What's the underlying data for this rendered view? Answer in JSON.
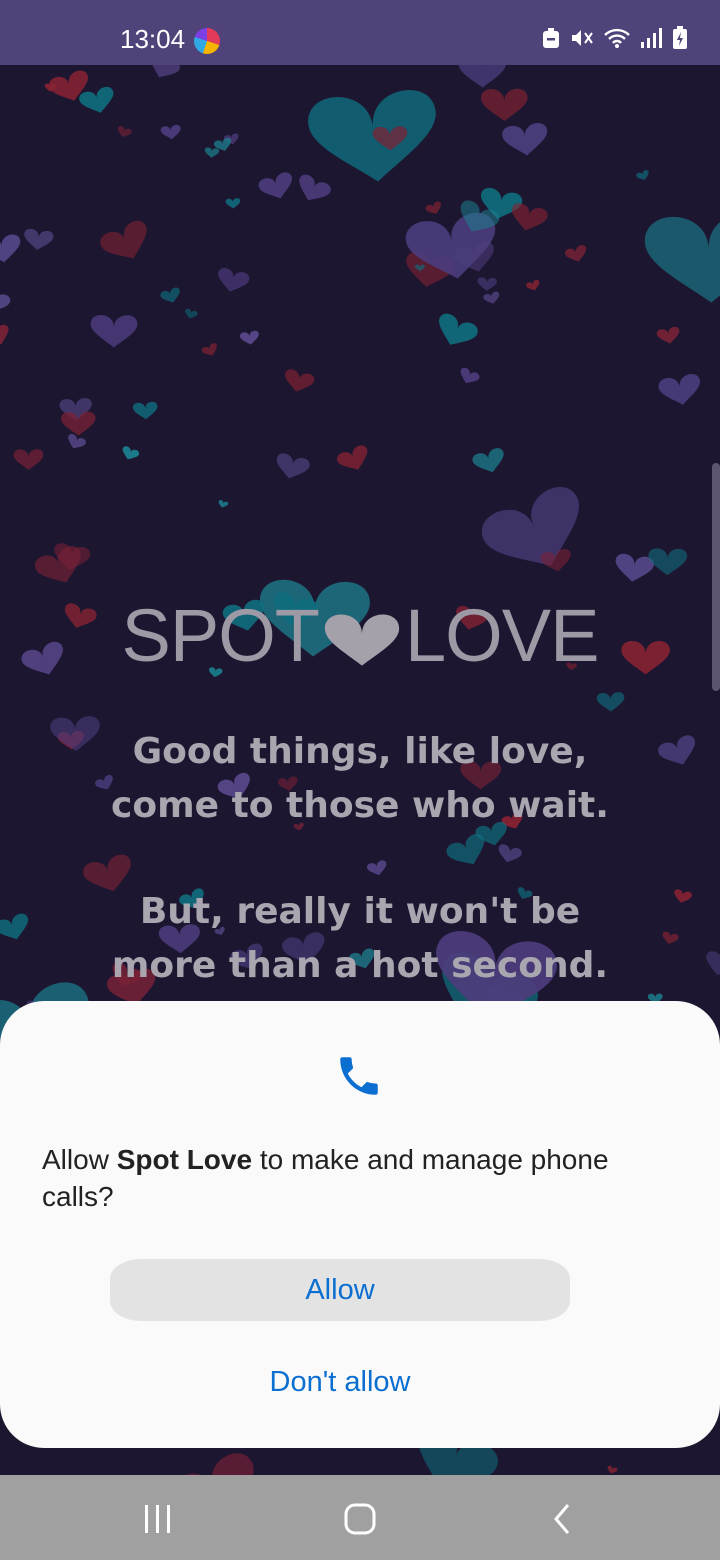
{
  "status_bar": {
    "time": "13:04",
    "icons": [
      "app-badge-icon",
      "do-not-disturb-icon",
      "mute-icon",
      "wifi-icon",
      "signal-icon",
      "battery-charging-icon"
    ]
  },
  "splash": {
    "logo_left": "SPOT",
    "logo_right": "LOVE",
    "tagline_1": [
      "Good things, like love,",
      "come to those who wait."
    ],
    "tagline_2": [
      "But, really it won't be",
      "more than a hot second."
    ]
  },
  "dialog": {
    "prompt_before": "Allow ",
    "app_name": "Spot Love",
    "prompt_after": " to make and manage phone calls?",
    "allow_label": "Allow",
    "deny_label": "Don't allow",
    "accent_color": "#0b6fd2"
  },
  "nav_bar": {
    "icons": [
      "recent-apps-icon",
      "home-icon",
      "back-icon"
    ]
  }
}
